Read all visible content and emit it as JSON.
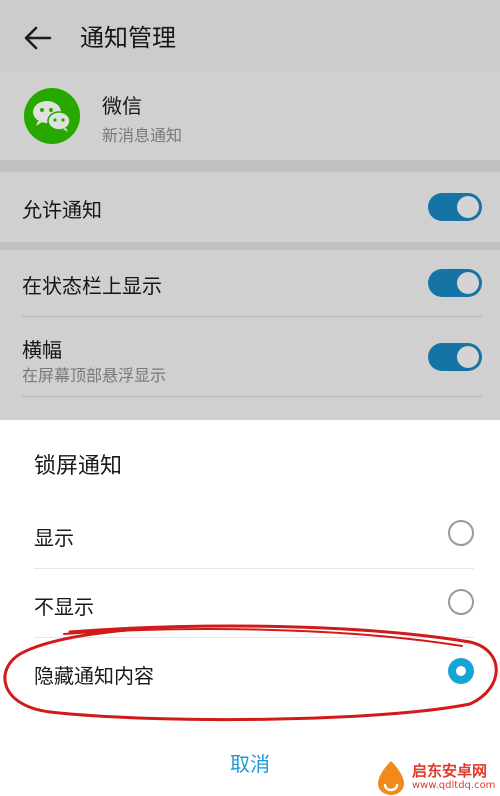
{
  "header": {
    "title": "通知管理"
  },
  "app": {
    "name": "微信",
    "subtitle": "新消息通知"
  },
  "settings": [
    {
      "title": "允许通知",
      "enabled": true
    },
    {
      "title": "在状态栏上显示",
      "enabled": true
    },
    {
      "title": "横幅",
      "subtitle": "在屏幕顶部悬浮显示",
      "enabled": true
    }
  ],
  "sheet": {
    "title": "锁屏通知",
    "options": [
      {
        "label": "显示",
        "selected": false
      },
      {
        "label": "不显示",
        "selected": false
      },
      {
        "label": "隐藏通知内容",
        "selected": true
      }
    ],
    "cancel": "取消"
  },
  "watermark": {
    "text": "启东安卓网",
    "url": "www.qdltdq.com"
  },
  "colors": {
    "accent": "#16a3d6",
    "toggle": "#1a83bd",
    "annotation": "#d21a1a",
    "wechat": "#2dc100"
  }
}
